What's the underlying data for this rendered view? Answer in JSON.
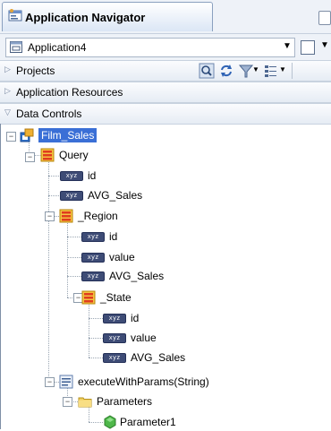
{
  "window": {
    "title": "Application Navigator"
  },
  "app_selector": {
    "value": "Application4"
  },
  "panels": {
    "projects": "Projects",
    "resources": "Application Resources",
    "data_controls": "Data Controls"
  },
  "tree": {
    "root": "Film_Sales",
    "query": "Query",
    "q_id": "id",
    "q_avg": "AVG_Sales",
    "region": "_Region",
    "r_id": "id",
    "r_value": "value",
    "r_avg": "AVG_Sales",
    "state": "_State",
    "s_id": "id",
    "s_value": "value",
    "s_avg": "AVG_Sales",
    "method": "executeWithParams(String)",
    "params": "Parameters",
    "param1": "Parameter1"
  },
  "icons": {
    "attribute_badge": "xyz"
  },
  "colors": {
    "selection": "#3a6fd6",
    "accent": "#e03c1e"
  }
}
